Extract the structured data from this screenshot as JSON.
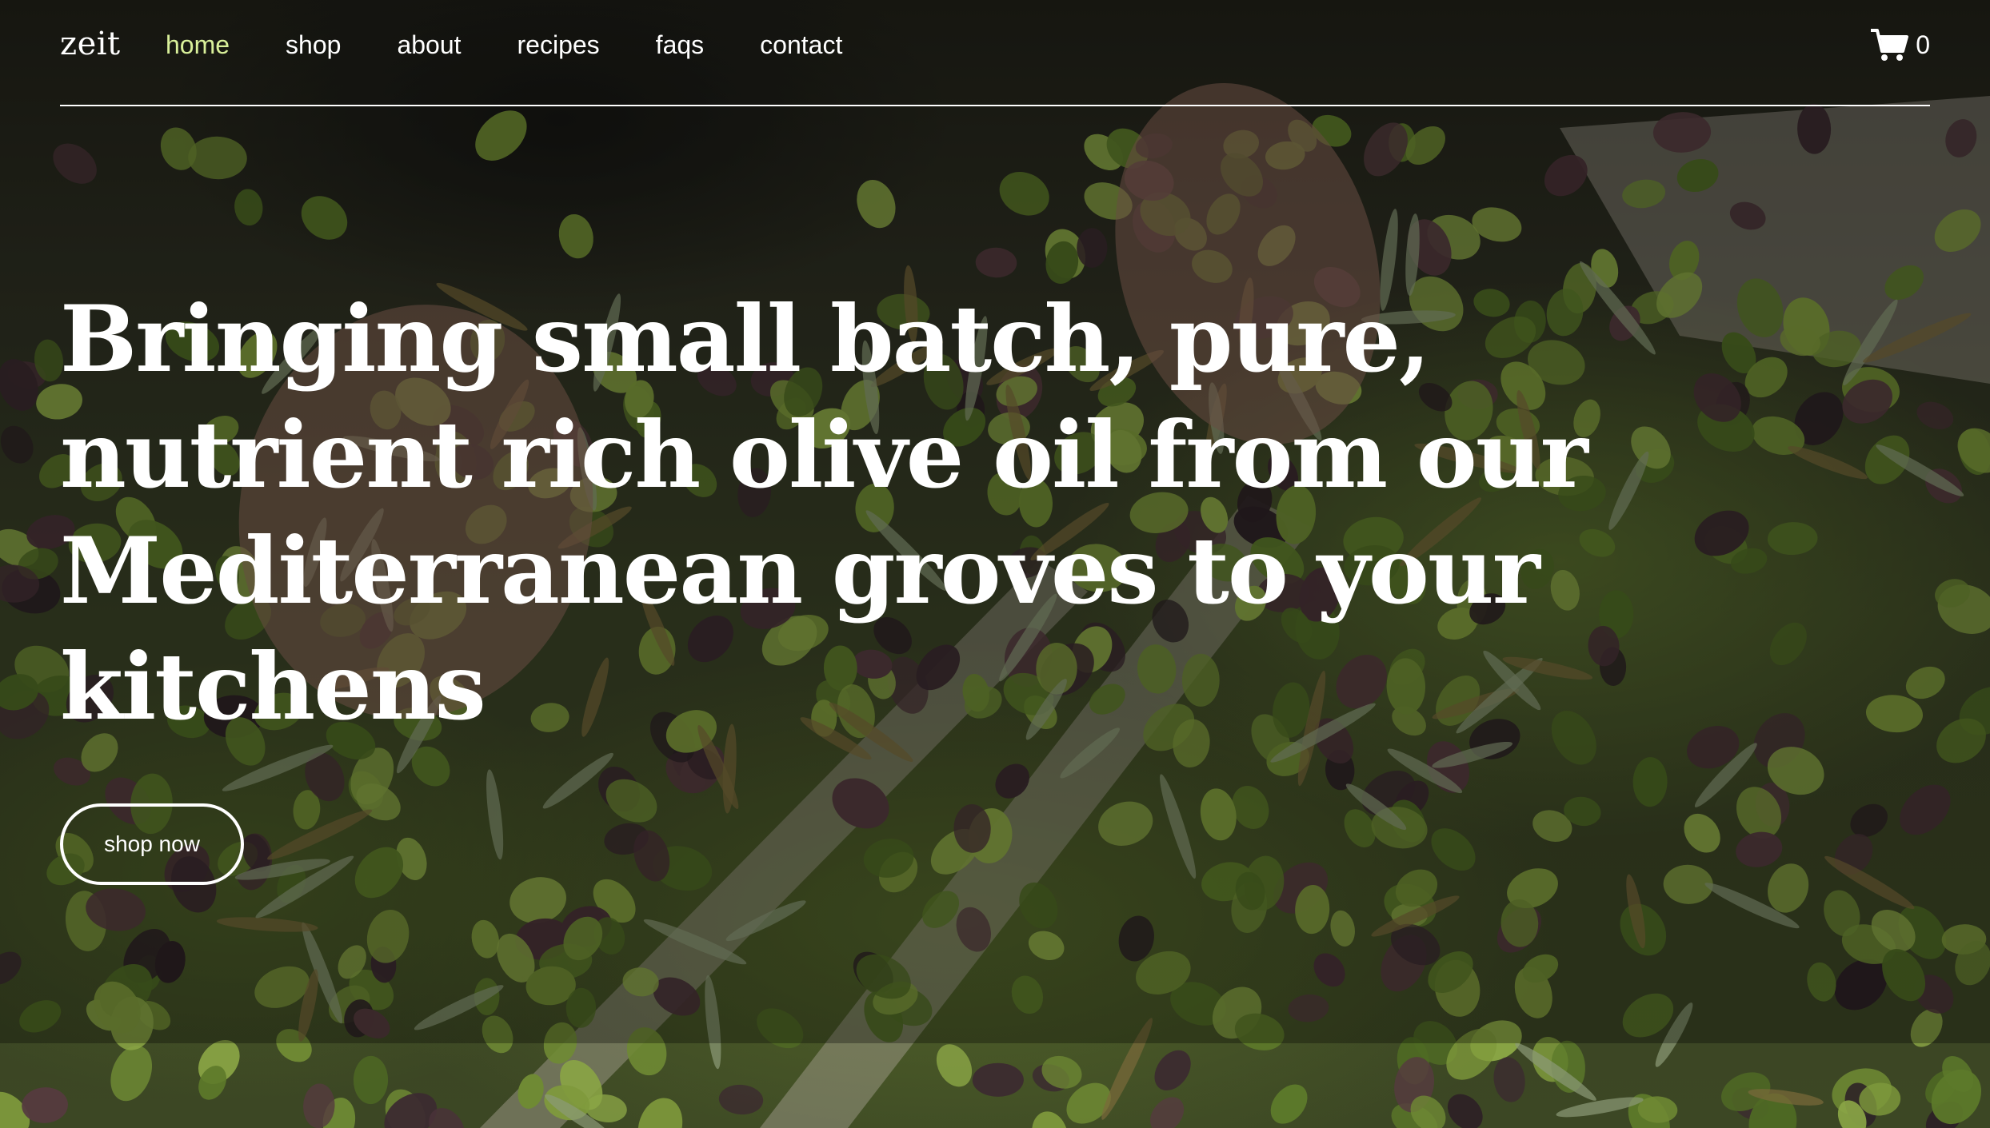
{
  "brand": {
    "logo_text": "zeit"
  },
  "nav": {
    "items": [
      {
        "label": "home",
        "active": true
      },
      {
        "label": "shop",
        "active": false
      },
      {
        "label": "about",
        "active": false
      },
      {
        "label": "recipes",
        "active": false
      },
      {
        "label": "faqs",
        "active": false
      },
      {
        "label": "contact",
        "active": false
      }
    ],
    "active_color": "#d9f09a"
  },
  "cart": {
    "icon": "cart-icon",
    "count": "0"
  },
  "hero": {
    "headline": "Bringing small batch, pure, nutrient rich olive oil from our Mediterranean groves to your kitchens",
    "cta_label": "shop now",
    "background": "olive harvest photo"
  }
}
